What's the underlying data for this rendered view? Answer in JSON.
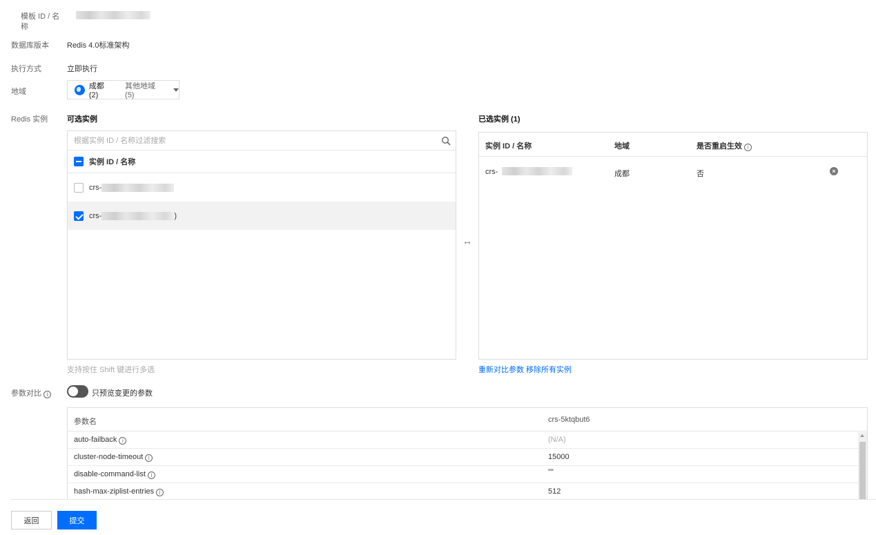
{
  "form": {
    "template_label_line1": "模板 ID / 名",
    "template_label_line2": "称",
    "db_version_label": "数据库版本",
    "db_version_value": "Redis 4.0标准架构",
    "exec_mode_label": "执行方式",
    "exec_mode_value": "立即执行",
    "region_label": "地域",
    "region_selected": "成都 (2)",
    "region_other": "其他地域 (5)",
    "instance_label": "Redis 实例"
  },
  "available": {
    "title": "可选实例",
    "search_placeholder": "根据实例 ID / 名称过滤搜索",
    "column_header": "实例 ID / 名称",
    "rows": [
      {
        "prefix": "crs-",
        "suffix": "",
        "checked": false
      },
      {
        "prefix": "crs-",
        "suffix": ")",
        "checked": true
      }
    ],
    "hint": "支持按住 Shift 键进行多选"
  },
  "transfer_arrow": "↔",
  "selected": {
    "title": "已选实例 (1)",
    "columns": {
      "id": "实例 ID / 名称",
      "region": "地域",
      "restart": "是否重启生效"
    },
    "rows": [
      {
        "prefix": "crs-",
        "region": "成都",
        "restart": "否"
      }
    ],
    "recompare_link": "重新对比参数",
    "remove_all_link": "移除所有实例"
  },
  "compare": {
    "label": "参数对比",
    "toggle_label": "只预览变更的参数",
    "toggle_on": false,
    "columns": {
      "param": "参数名",
      "instance": "crs-5ktqbut6"
    },
    "rows": [
      {
        "name": "auto-failback",
        "value": "(N/A)"
      },
      {
        "name": "cluster-node-timeout",
        "value": "15000"
      },
      {
        "name": "disable-command-list",
        "value": "\"\""
      },
      {
        "name": "hash-max-ziplist-entries",
        "value": "512"
      }
    ]
  },
  "footer": {
    "back_label": "返回",
    "submit_label": "提交"
  },
  "colors": {
    "primary": "#006eff",
    "toggle_off": "#555555"
  },
  "icons": {
    "info": "i",
    "delete": "×",
    "search": "search-icon",
    "globe": "globe-icon"
  }
}
